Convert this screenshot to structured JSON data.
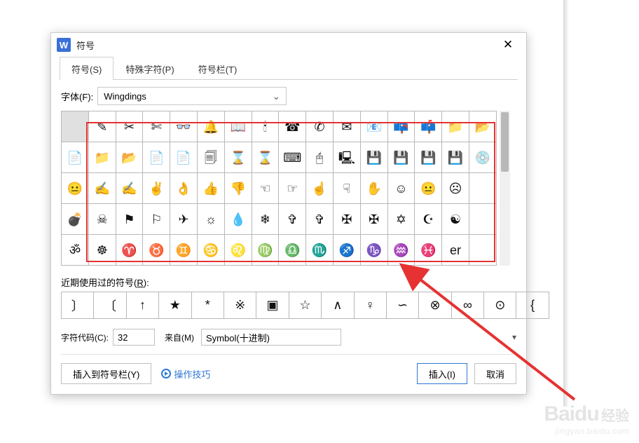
{
  "dialog": {
    "title": "符号",
    "tabs": [
      {
        "label": "符号(S)",
        "active": true
      },
      {
        "label": "特殊字符(P)",
        "active": false
      },
      {
        "label": "符号栏(T)",
        "active": false
      }
    ],
    "font_label": "字体(F):",
    "font_value": "Wingdings",
    "recent_label_prefix": "近期使用过的符号(",
    "recent_label_key": "R",
    "recent_label_suffix": "):",
    "code_label": "字符代码(C):",
    "code_value": "32",
    "from_label": "来自(M)",
    "from_value": "Symbol(十进制)",
    "btn_toolbar": "插入到符号栏(Y)",
    "btn_tips": "操作技巧",
    "btn_insert": "插入(I)",
    "btn_cancel": "取消"
  },
  "symbol_rows": [
    [
      "",
      "✎",
      "✂",
      "✄",
      "👓",
      "🔔",
      "📖",
      "🕯",
      "☎",
      "✆",
      "✉",
      "📧",
      "📪",
      "📫",
      "📁",
      "📂"
    ],
    [
      "📄",
      "📁",
      "📂",
      "📄",
      "📄",
      "🗐",
      "⌛",
      "⌛",
      "⌨",
      "🖰",
      "🖳",
      "💾",
      "💾",
      "💾",
      "💾",
      "💿"
    ],
    [
      "😐",
      "✍",
      "✍",
      "✌",
      "👌",
      "👍",
      "👎",
      "☜",
      "☞",
      "☝",
      "☟",
      "✋",
      "☺",
      "😐",
      "☹",
      ""
    ],
    [
      "💣",
      "☠",
      "⚑",
      "⚐",
      "✈",
      "☼",
      "💧",
      "❄",
      "✞",
      "✞",
      "✠",
      "✠",
      "✡",
      "☪",
      "☯",
      ""
    ],
    [
      "ॐ",
      "☸",
      "♈",
      "♉",
      "♊",
      "♋",
      "♌",
      "♍",
      "♎",
      "♏",
      "♐",
      "♑",
      "♒",
      "♓",
      "er",
      ""
    ]
  ],
  "recent_symbols": [
    "〕",
    "〔",
    "↑",
    "★",
    "*",
    "※",
    "▣",
    "☆",
    "∧",
    "♀",
    "∽",
    "⊗",
    "∞",
    "⊙",
    "{"
  ],
  "watermark": {
    "brand": "Baidu",
    "exp": "经验",
    "url": "jingyan.baidu.com"
  }
}
